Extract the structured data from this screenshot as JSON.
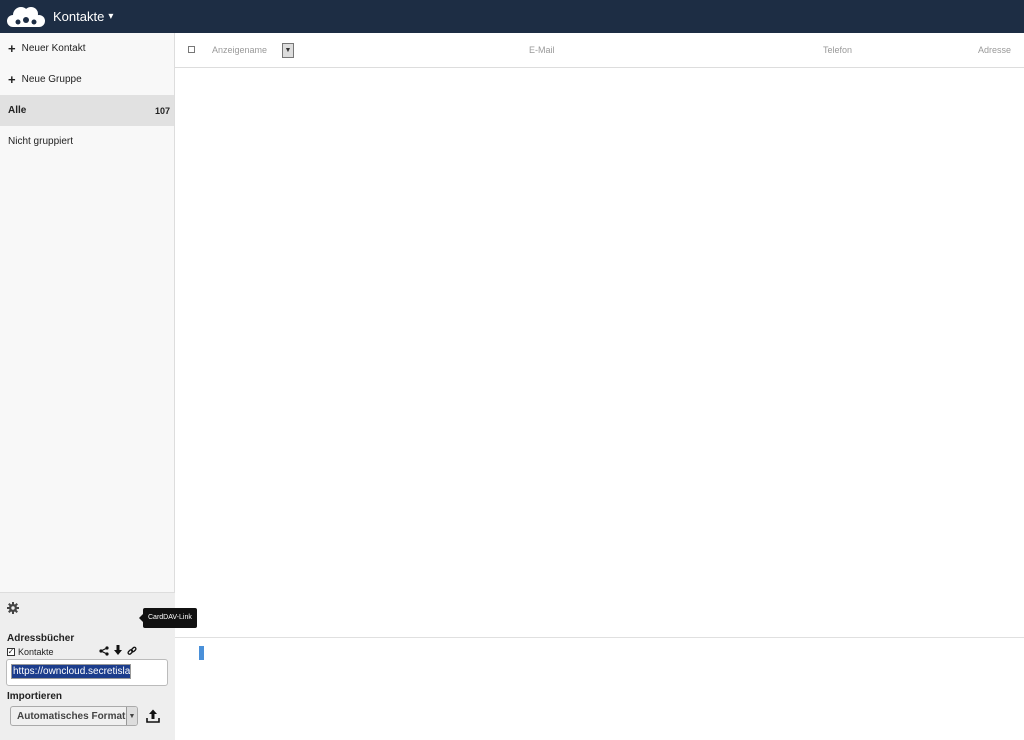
{
  "header": {
    "app_title": "Kontakte",
    "caret": "▾",
    "background_color": "#1d2d44"
  },
  "sidebar": {
    "new_contact_label": "Neuer Kontakt",
    "new_group_label": "Neue Gruppe",
    "groups": [
      {
        "label": "Alle",
        "count": "107"
      },
      {
        "label": "Nicht gruppiert"
      }
    ]
  },
  "settings": {
    "addressbooks_heading": "Adressbücher",
    "addressbook_name": "Kontakte",
    "tooltip": "CardDAV-Link",
    "carddav_url": "https://owncloud.secretisla",
    "import_heading": "Importieren",
    "format_value": "Automatisches Format"
  },
  "table": {
    "columns": {
      "name": "Anzeigename",
      "email": "E-Mail",
      "phone": "Telefon",
      "address": "Adresse"
    }
  },
  "icons": {
    "logo": "owncloud-logo-icon",
    "gear": "gear-icon",
    "share": "share-icon",
    "download": "download-icon",
    "link": "link-icon",
    "upload": "upload-icon"
  }
}
